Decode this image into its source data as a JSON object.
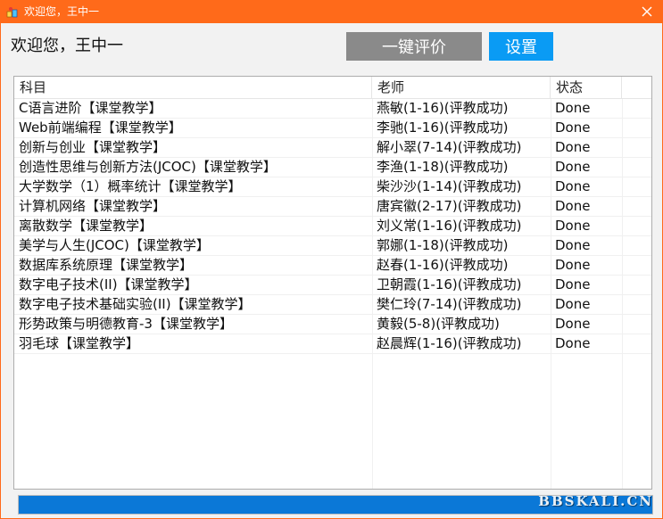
{
  "window": {
    "title": "欢迎您，王中一",
    "titlebar_color": "#ff6a1a",
    "app_icon": "app-logo-icon",
    "close_icon": "close-icon"
  },
  "header": {
    "welcome": "欢迎您，王中一",
    "eval_button": "一键评价",
    "settings_button": "设置"
  },
  "table": {
    "columns": [
      "科目",
      "老师",
      "状态"
    ],
    "rows": [
      {
        "subject": "C语言进阶【课堂教学】",
        "teacher": "燕敏(1-16)(评教成功)",
        "status": "Done"
      },
      {
        "subject": "Web前端编程【课堂教学】",
        "teacher": "李驰(1-16)(评教成功)",
        "status": "Done"
      },
      {
        "subject": "创新与创业【课堂教学】",
        "teacher": "解小翠(7-14)(评教成功)",
        "status": "Done"
      },
      {
        "subject": "创造性思维与创新方法(JCOC)【课堂教学】",
        "teacher": "李渔(1-18)(评教成功)",
        "status": "Done"
      },
      {
        "subject": "大学数学（1）概率统计【课堂教学】",
        "teacher": "柴沙沙(1-14)(评教成功)",
        "status": "Done"
      },
      {
        "subject": "计算机网络【课堂教学】",
        "teacher": "唐宾徽(2-17)(评教成功)",
        "status": "Done"
      },
      {
        "subject": "离散数学【课堂教学】",
        "teacher": "刘义常(1-16)(评教成功)",
        "status": "Done"
      },
      {
        "subject": "美学与人生(JCOC)【课堂教学】",
        "teacher": "郭娜(1-18)(评教成功)",
        "status": "Done"
      },
      {
        "subject": "数据库系统原理【课堂教学】",
        "teacher": "赵春(1-16)(评教成功)",
        "status": "Done"
      },
      {
        "subject": "数字电子技术(II)【课堂教学】",
        "teacher": "卫朝霞(1-16)(评教成功)",
        "status": "Done"
      },
      {
        "subject": "数字电子技术基础实验(II)【课堂教学】",
        "teacher": "樊仁玲(7-14)(评教成功)",
        "status": "Done"
      },
      {
        "subject": "形势政策与明德教育-3【课堂教学】",
        "teacher": "黄毅(5-8)(评教成功)",
        "status": "Done"
      },
      {
        "subject": "羽毛球【课堂教学】",
        "teacher": "赵晨辉(1-16)(评教成功)",
        "status": "Done"
      }
    ]
  },
  "progress": {
    "percent": 100,
    "fill_color": "#0b78d7"
  },
  "watermark": "BBSKALI.CN"
}
